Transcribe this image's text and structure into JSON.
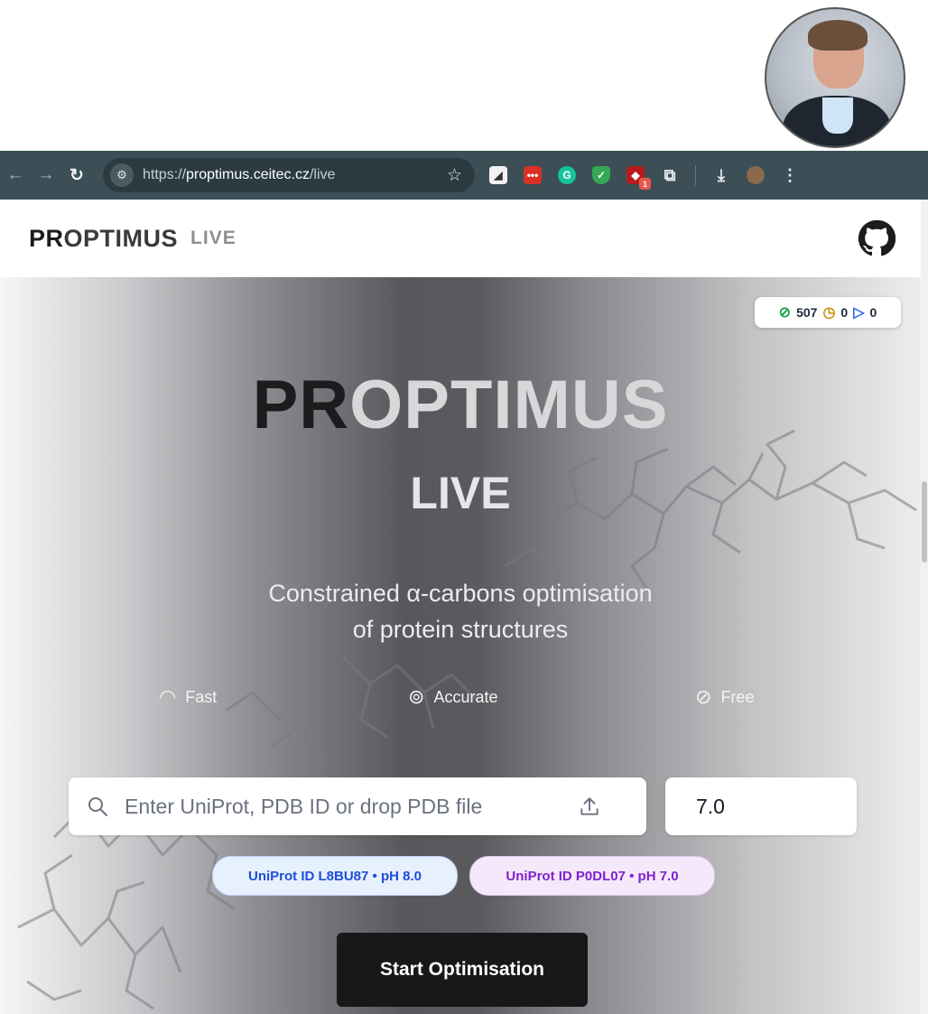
{
  "browser": {
    "url_prefix": "https://",
    "url_domain": "proptimus.ceitec.cz",
    "url_path": "/live",
    "extension_badge": "1"
  },
  "header": {
    "brand_bold": "PR",
    "brand_rest": "OPTIMUS",
    "brand_sub": "LIVE"
  },
  "status": {
    "completed": "507",
    "pending": "0",
    "running": "0"
  },
  "hero": {
    "title_dark": "PR",
    "title_light": "OPTIMUS",
    "subtitle": "LIVE",
    "tagline_line1": "Constrained α-carbons optimisation",
    "tagline_line2": "of protein structures"
  },
  "features": [
    {
      "label": "Fast",
      "icon": "gauge-icon"
    },
    {
      "label": "Accurate",
      "icon": "target-icon"
    },
    {
      "label": "Free",
      "icon": "check-circle-icon"
    }
  ],
  "search": {
    "placeholder": "Enter UniProt, PDB ID or drop PDB file",
    "ph_value": "7.0"
  },
  "examples": [
    {
      "label": "UniProt ID L8BU87 • pH 8.0"
    },
    {
      "label": "UniProt ID P0DL07 • pH 7.0"
    }
  ],
  "start_button": "Start Optimisation",
  "colors": {
    "browser_bar": "#3c4f56",
    "button_dark": "#18181b",
    "example_blue": "#1d4ed8",
    "example_purple": "#7e22ce",
    "status_green": "#16a34a",
    "status_yellow": "#ca8a04",
    "status_blue": "#2563eb"
  }
}
